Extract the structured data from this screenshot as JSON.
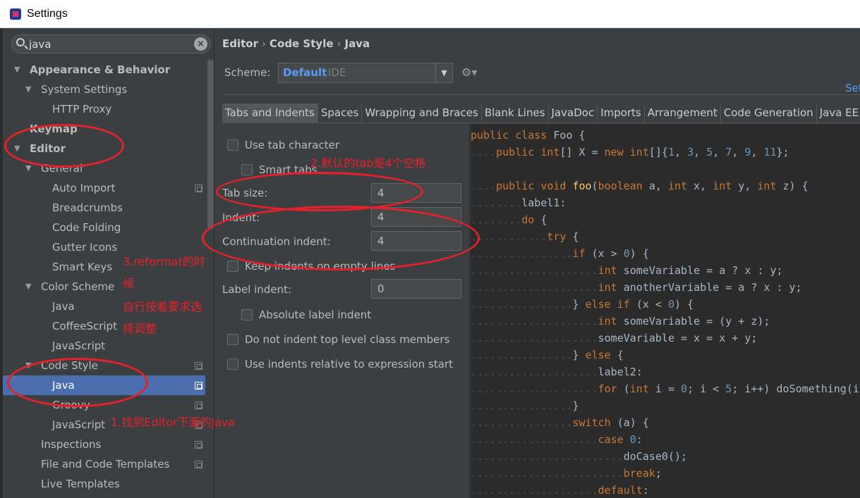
{
  "window": {
    "title": "Settings"
  },
  "search": {
    "value": "java"
  },
  "tree": [
    {
      "label": "Appearance & Behavior",
      "depth": 0,
      "arrow": "▼",
      "bold": true
    },
    {
      "label": "System Settings",
      "depth": 1,
      "arrow": "▼"
    },
    {
      "label": "HTTP Proxy",
      "depth": 2
    },
    {
      "label": "Keymap",
      "depth": 0,
      "bold": true
    },
    {
      "label": "Editor",
      "depth": 0,
      "arrow": "▼",
      "bold": true
    },
    {
      "label": "General",
      "depth": 1,
      "arrow": "▼"
    },
    {
      "label": "Auto Import",
      "depth": 2,
      "copy": true
    },
    {
      "label": "Breadcrumbs",
      "depth": 2
    },
    {
      "label": "Code Folding",
      "depth": 2
    },
    {
      "label": "Gutter Icons",
      "depth": 2
    },
    {
      "label": "Smart Keys",
      "depth": 2
    },
    {
      "label": "Color Scheme",
      "depth": 1,
      "arrow": "▼"
    },
    {
      "label": "Java",
      "depth": 2
    },
    {
      "label": "CoffeeScript",
      "depth": 2
    },
    {
      "label": "JavaScript",
      "depth": 2
    },
    {
      "label": "Code Style",
      "depth": 1,
      "arrow": "▼",
      "copy": true
    },
    {
      "label": "Java",
      "depth": 2,
      "copy": true,
      "selected": true
    },
    {
      "label": "Groovy",
      "depth": 2,
      "copy": true
    },
    {
      "label": "JavaScript",
      "depth": 2,
      "copy": true
    },
    {
      "label": "Inspections",
      "depth": 1,
      "copy": true
    },
    {
      "label": "File and Code Templates",
      "depth": 1,
      "copy": true
    },
    {
      "label": "Live Templates",
      "depth": 1
    }
  ],
  "breadcrumb": {
    "p1": "Editor",
    "p2": "Code Style",
    "p3": "Java",
    "sep": "›"
  },
  "scheme": {
    "label": "Scheme:",
    "value": "Default",
    "tag": "IDE",
    "set_from": "Set"
  },
  "tabs": [
    "Tabs and Indents",
    "Spaces",
    "Wrapping and Braces",
    "Blank Lines",
    "JavaDoc",
    "Imports",
    "Arrangement",
    "Code Generation",
    "Java EE Na"
  ],
  "options": {
    "use_tab": "Use tab character",
    "smart_tabs": "Smart tabs",
    "tab_size_label": "Tab size:",
    "tab_size": "4",
    "indent_label": "Indent:",
    "indent": "4",
    "cont_indent_label": "Continuation indent:",
    "cont_indent": "4",
    "keep_indents": "Keep indents on empty lines",
    "label_indent_label": "Label indent:",
    "label_indent": "0",
    "abs_label": "Absolute label indent",
    "no_top": "Do not indent top level class members",
    "relative": "Use indents relative to expression start"
  },
  "annotations": {
    "a1": "1.找到Editor下面的java",
    "a2": "2.默认的tab是4个空格",
    "a3_1": "3.reformat的时",
    "a3_2": "候",
    "a3_3": "自行按着要求选",
    "a3_4": "择调整"
  },
  "code": [
    {
      "i": 0,
      "s": [
        [
          "k",
          "public class "
        ],
        [
          "p",
          "Foo {"
        ]
      ]
    },
    {
      "i": 4,
      "s": [
        [
          "k",
          "public "
        ],
        [
          "k",
          "int"
        ],
        [
          "p",
          "[] X = "
        ],
        [
          "k",
          "new int"
        ],
        [
          "p",
          "[]{"
        ],
        [
          "n",
          "1"
        ],
        [
          "p",
          ", "
        ],
        [
          "n",
          "3"
        ],
        [
          "p",
          ", "
        ],
        [
          "n",
          "5"
        ],
        [
          "p",
          ", "
        ],
        [
          "n",
          "7"
        ],
        [
          "p",
          ", "
        ],
        [
          "n",
          "9"
        ],
        [
          "p",
          ", "
        ],
        [
          "n",
          "11"
        ],
        [
          "p",
          "};"
        ]
      ]
    },
    {
      "i": 0,
      "s": []
    },
    {
      "i": 4,
      "s": [
        [
          "k",
          "public void "
        ],
        [
          "f",
          "foo"
        ],
        [
          "p",
          "("
        ],
        [
          "k",
          "boolean "
        ],
        [
          "p",
          "a, "
        ],
        [
          "k",
          "int "
        ],
        [
          "p",
          "x, "
        ],
        [
          "k",
          "int "
        ],
        [
          "p",
          "y, "
        ],
        [
          "k",
          "int "
        ],
        [
          "p",
          "z) {"
        ]
      ]
    },
    {
      "i": 8,
      "s": [
        [
          "p",
          "label1:"
        ]
      ]
    },
    {
      "i": 8,
      "s": [
        [
          "k",
          "do "
        ],
        [
          "p",
          "{"
        ]
      ]
    },
    {
      "i": 12,
      "s": [
        [
          "k",
          "try "
        ],
        [
          "p",
          "{"
        ]
      ]
    },
    {
      "i": 16,
      "s": [
        [
          "k",
          "if "
        ],
        [
          "p",
          "(x > "
        ],
        [
          "n",
          "0"
        ],
        [
          "p",
          ") {"
        ]
      ]
    },
    {
      "i": 20,
      "s": [
        [
          "k",
          "int "
        ],
        [
          "p",
          "someVariable = a ? x : y;"
        ]
      ]
    },
    {
      "i": 20,
      "s": [
        [
          "k",
          "int "
        ],
        [
          "p",
          "anotherVariable = a ? x : y;"
        ]
      ]
    },
    {
      "i": 16,
      "s": [
        [
          "p",
          "} "
        ],
        [
          "k",
          "else if "
        ],
        [
          "p",
          "(x < "
        ],
        [
          "n",
          "0"
        ],
        [
          "p",
          ") {"
        ]
      ]
    },
    {
      "i": 20,
      "s": [
        [
          "k",
          "int "
        ],
        [
          "p",
          "someVariable = (y + z);"
        ]
      ]
    },
    {
      "i": 20,
      "s": [
        [
          "p",
          "someVariable = x = x + y;"
        ]
      ]
    },
    {
      "i": 16,
      "s": [
        [
          "p",
          "} "
        ],
        [
          "k",
          "else "
        ],
        [
          "p",
          "{"
        ]
      ]
    },
    {
      "i": 20,
      "s": [
        [
          "p",
          "label2:"
        ]
      ]
    },
    {
      "i": 20,
      "s": [
        [
          "k",
          "for "
        ],
        [
          "p",
          "("
        ],
        [
          "k",
          "int "
        ],
        [
          "p",
          "i = "
        ],
        [
          "n",
          "0"
        ],
        [
          "p",
          "; i < "
        ],
        [
          "n",
          "5"
        ],
        [
          "p",
          "; i++) doSomething(i);"
        ]
      ]
    },
    {
      "i": 16,
      "s": [
        [
          "p",
          "}"
        ]
      ]
    },
    {
      "i": 16,
      "s": [
        [
          "k",
          "switch "
        ],
        [
          "p",
          "(a) {"
        ]
      ]
    },
    {
      "i": 20,
      "s": [
        [
          "k",
          "case "
        ],
        [
          "n",
          "0"
        ],
        [
          "p",
          ":"
        ]
      ]
    },
    {
      "i": 24,
      "s": [
        [
          "p",
          "doCase0();"
        ]
      ]
    },
    {
      "i": 24,
      "s": [
        [
          "k",
          "break"
        ],
        [
          "p",
          ";"
        ]
      ]
    },
    {
      "i": 20,
      "s": [
        [
          "k",
          "default"
        ],
        [
          "p",
          ":"
        ]
      ]
    }
  ]
}
